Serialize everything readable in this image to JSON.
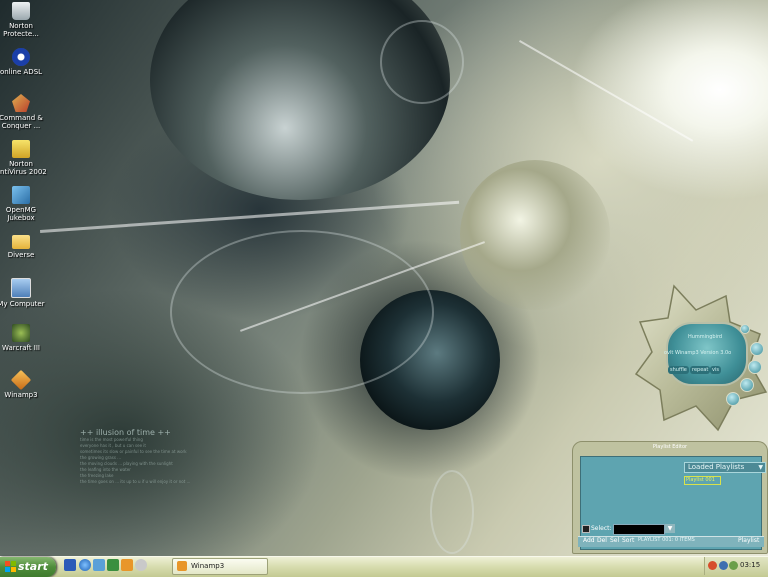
{
  "desktop": {
    "icons": [
      {
        "label": "Norton\nProtecte...",
        "icon": "recycle-bin-icon",
        "color": "#d8e0e4"
      },
      {
        "label": "online ADSL",
        "icon": "adsl-icon",
        "color": "#1b3fa8"
      },
      {
        "label": "Command &\nConquer ...",
        "icon": "command-conquer-icon",
        "color": "#b9402c"
      },
      {
        "label": "Norton\nAntiVirus 2002",
        "icon": "norton-antivirus-icon",
        "color": "#e3c33a"
      },
      {
        "label": "OpenMG\nJukebox",
        "icon": "openmg-jukebox-icon",
        "color": "#3e8ec9"
      },
      {
        "label": "Diverse",
        "icon": "folder-icon",
        "color": "#f2c74a"
      },
      {
        "label": "My Computer",
        "icon": "my-computer-icon",
        "color": "#6d9ed6"
      },
      {
        "label": "Warcraft III",
        "icon": "warcraft-iii-icon",
        "color": "#3f6d2e"
      },
      {
        "label": "Winamp3",
        "icon": "winamp-icon",
        "color": "#e8962a"
      }
    ],
    "wallpaper_text": {
      "title": "++ illusion of time ++",
      "lines": [
        "time is the most powerful thing",
        "everyone has it , but u can see it",
        "sometimes its slow or painful to see the time at work",
        "the growing grass ...",
        "the moving clouds ... playing with the sunlight",
        "the leafing into the water",
        "the freezing lake",
        "the time goes on ... its up to u if u will enjoy it or not ..."
      ]
    }
  },
  "winamp": {
    "mini_label": "Winamp3",
    "display_text": "ovlt Winamp3 Version 3.0o",
    "subline": "Hummingbird",
    "btn_left": "shuffle",
    "btn_mid": "repeat",
    "btn_right": "vis"
  },
  "playlist": {
    "title": "Playlist Editor",
    "dropdown_label": "Loaded Playlists",
    "item": "Playlist 001",
    "select_label": "Select:",
    "info": "PLAYLIST 001: 0 ITEMS",
    "buttons": {
      "add": "Add",
      "del": "Del",
      "sel": "Sel",
      "sort": "Sort",
      "playlist": "Playlist"
    }
  },
  "taskbar": {
    "start_label": "start",
    "task": "Winamp3",
    "clock": "03:15",
    "quick_launch": [
      "word-icon",
      "ie-icon",
      "explorer-icon",
      "media-icon",
      "winamp-small-icon",
      "app-icon"
    ]
  },
  "colors": {
    "taskbar": "#d7dcae",
    "start": "#4f8d3b",
    "playlist_panel": "#5ea4b0",
    "skin": "#bfc2a0"
  }
}
